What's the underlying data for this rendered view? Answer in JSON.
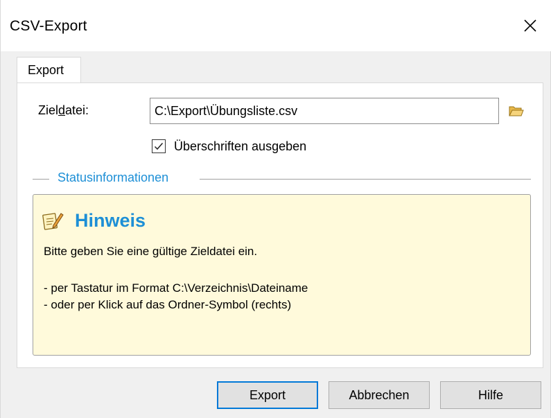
{
  "window": {
    "title": "CSV-Export",
    "close_icon": "close-icon"
  },
  "tabs": [
    {
      "label": "Export",
      "selected": true
    }
  ],
  "form": {
    "target_label_prefix": "Ziel",
    "target_label_underlined": "d",
    "target_label_suffix": "atei:",
    "target_value": "C:\\Export\\Übungsliste.csv",
    "browse_icon": "folder-open-icon",
    "headers_checkbox_label": "Überschriften ausgeben",
    "headers_checked": true
  },
  "status": {
    "group_title": "Statusinformationen",
    "hint_icon": "note-pencil-icon",
    "hint_title": "Hinweis",
    "hint_text": "Bitte geben Sie eine gültige Zieldatei ein.",
    "hint_lines": [
      "- per Tastatur im Format C:\\Verzeichnis\\Dateiname",
      "- oder per Klick auf das Ordner-Symbol (rechts)"
    ]
  },
  "buttons": {
    "export": "Export",
    "cancel": "Abbrechen",
    "help": "Hilfe"
  },
  "colors": {
    "accent": "#1d8fd6",
    "hint_background": "#fffadb",
    "default_button_border": "#0078d7"
  }
}
